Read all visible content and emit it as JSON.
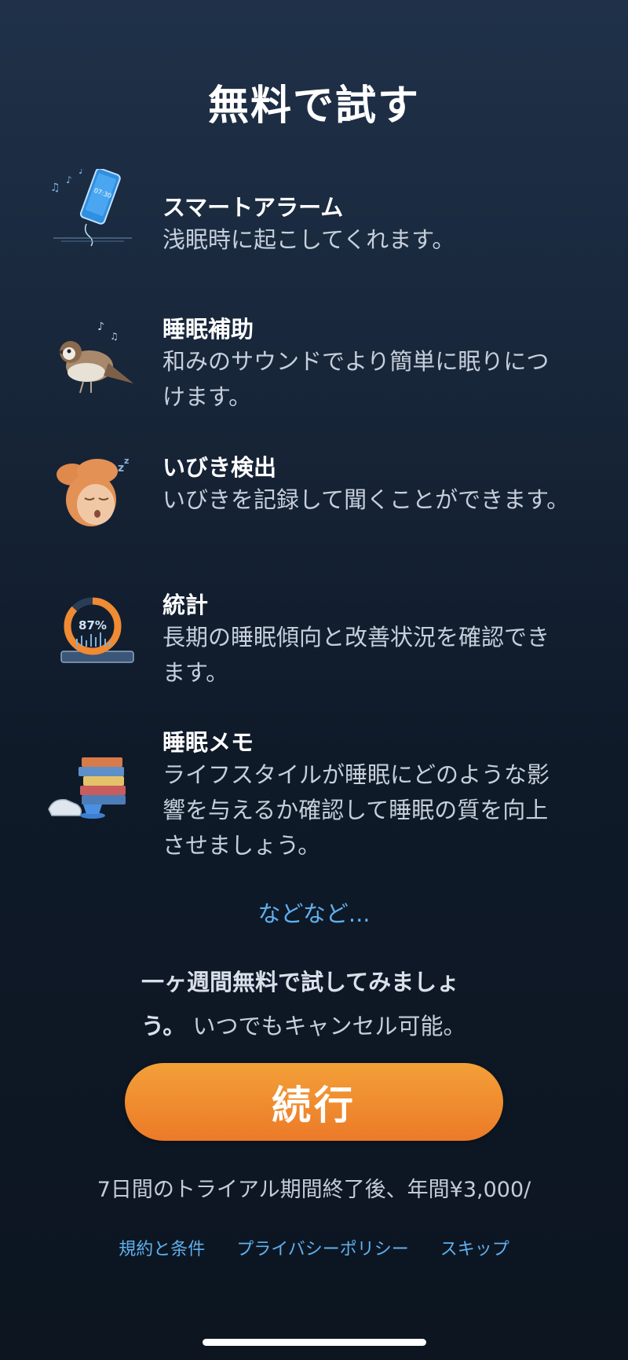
{
  "page": {
    "title": "無料で試す"
  },
  "features": [
    {
      "icon": "smartphone-alarm-icon",
      "title": "スマートアラーム",
      "description": "浅眠時に起こしてくれます。"
    },
    {
      "icon": "sparrow-bird-icon",
      "title": "睡眠補助",
      "description": "和みのサウンドでより簡単に眠りにつけます。"
    },
    {
      "icon": "snoring-face-icon",
      "title": "いびき検出",
      "description": "いびきを記録して聞くことができます。"
    },
    {
      "icon": "statistics-gauge-icon",
      "title": "統計",
      "description": "長期の睡眠傾向と改善状況を確認できます。",
      "gauge_label": "87%",
      "gauge_value": 0.87
    },
    {
      "icon": "books-sneaker-cup-icon",
      "title": "睡眠メモ",
      "description": "ライフスタイルが睡眠にどのような影響を与えるか確認して睡眠の質を向上させましょう。"
    }
  ],
  "more_link": "などなど...",
  "trial": {
    "bold": "一ヶ週間無料で試してみましょう。",
    "normal": "いつでもキャンセル可能。"
  },
  "cta_label": "続行",
  "price_text": "7日間のトライアル期間終了後、年間¥3,000/",
  "footer_links": {
    "terms": "規約と条件",
    "privacy": "プライバシーポリシー",
    "skip": "スキップ"
  },
  "colors": {
    "accent_orange": "#ee8a2e",
    "link_blue": "#5fb0ee",
    "background_top": "#1f3149",
    "background_bottom": "#0c1520"
  }
}
